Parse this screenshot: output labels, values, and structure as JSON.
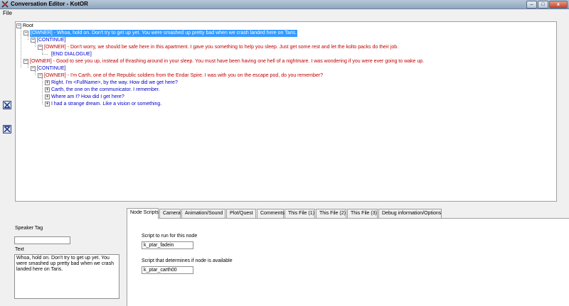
{
  "window": {
    "title": "Conversation Editor - KotOR",
    "minimize": "–",
    "maximize": "□",
    "close": "x"
  },
  "menu": {
    "file": "File"
  },
  "tree": {
    "root": "Root",
    "nodes": [
      {
        "text": "[OWNER] - Whoa, hold on. Don't try to get up yet. You were smashed up pretty bad when we crash landed here on Taris.",
        "color": "red",
        "selected": true
      },
      {
        "text": "[CONTINUE]",
        "color": "blue"
      },
      {
        "text": "[OWNER] -  Don't worry, we should be safe here in this apartment. I gave you something to help you sleep. Just get some rest and let the kolto packs do their job.",
        "color": "red"
      },
      {
        "text": "[END DIALOGUE]",
        "color": "blue"
      },
      {
        "text": "[OWNER] - Good to see you up, instead of thrashing around in your sleep. You must have been having one hell of a nightmare. I was wondering if you were ever going to wake up.",
        "color": "red"
      },
      {
        "text": "[CONTINUE]",
        "color": "blue"
      },
      {
        "text": "[OWNER] - I'm Carth, one of the Republic soldiers from the Endar Spire. I was with you on the escape pod, do you remember?",
        "color": "red"
      },
      {
        "text": "Right. I'm <FullName>, by the way. How did we get here?",
        "color": "blue"
      },
      {
        "text": "Carth, the one on the communicator. I remember.",
        "color": "blue"
      },
      {
        "text": "Where am I? How did I get here?",
        "color": "blue"
      },
      {
        "text": "I had a strange dream. Like a vision or something.",
        "color": "blue"
      }
    ]
  },
  "tabs": [
    "Node Scripts",
    "Camera",
    "Animation/Sound",
    "Plot/Quest",
    "Comments",
    "This File (1)",
    "This File (2)",
    "This File (3)",
    "Debug information/Options"
  ],
  "speaker": {
    "label": "Speaker Tag",
    "value": "",
    "text_label": "Text",
    "text_value": "Whoa, hold on. Don't try to get up yet. You were smashed up pretty bad when we crash landed here on Taris."
  },
  "node_scripts": {
    "script_label": "Script to run for this node",
    "script_value": "k_ptar_fadein",
    "avail_label": "Script that determines if node is available",
    "avail_value": "k_ptar_carth00"
  },
  "colors": {
    "red": "#c00000",
    "blue": "#0000c8",
    "selection": "#3399ff"
  }
}
